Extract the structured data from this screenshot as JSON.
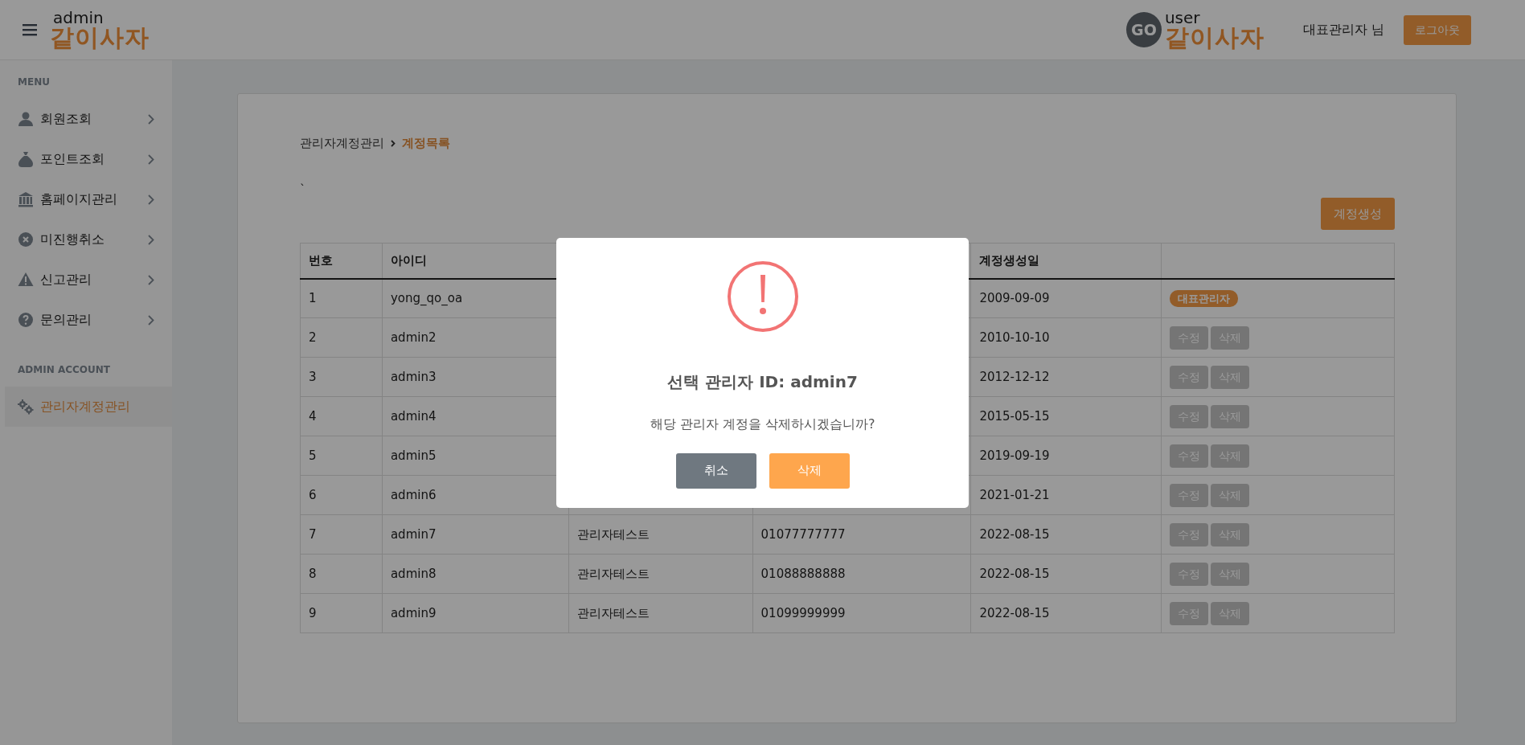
{
  "header": {
    "logo": {
      "sub": "admin",
      "main": "같이사자"
    },
    "user_logo": {
      "badge": "GO",
      "sub": "user",
      "main": "같이사자"
    },
    "user_name": "대표관리자 님",
    "logout": "로그아웃"
  },
  "sidebar": {
    "sections": [
      {
        "title": "MENU",
        "items": [
          {
            "label": "회원조회",
            "has_submenu": true,
            "selected": false
          },
          {
            "label": "포인트조회",
            "has_submenu": true,
            "selected": false
          },
          {
            "label": "홈페이지관리",
            "has_submenu": true,
            "selected": false
          },
          {
            "label": "미진행취소",
            "has_submenu": true,
            "selected": false
          },
          {
            "label": "신고관리",
            "has_submenu": true,
            "selected": false
          },
          {
            "label": "문의관리",
            "has_submenu": true,
            "selected": false
          }
        ]
      },
      {
        "title": "ADMIN ACCOUNT",
        "items": [
          {
            "label": "관리자계정관리",
            "has_submenu": false,
            "selected": true
          }
        ]
      }
    ]
  },
  "breadcrumb": [
    {
      "label": "관리자계정관리",
      "current": false
    },
    {
      "label": "계정목록",
      "current": true
    }
  ],
  "stray_mark": "`",
  "create_button": "계정생성",
  "table": {
    "columns": [
      {
        "label": "번호"
      },
      {
        "label": "아이디"
      },
      {},
      {},
      {
        "label": "계정생성일"
      },
      {}
    ],
    "rows": [
      {
        "number": "1",
        "id": "yong_qo_oa",
        "created": "2009-09-09",
        "kind": "owner",
        "badge": "대표관리자"
      },
      {
        "number": "2",
        "id": "admin2",
        "created": "2010-10-10",
        "kind": "editable",
        "actions": [
          "수정",
          "삭제"
        ]
      },
      {
        "number": "3",
        "id": "admin3",
        "created": "2012-12-12",
        "kind": "editable",
        "actions": [
          "수정",
          "삭제"
        ]
      },
      {
        "number": "4",
        "id": "admin4",
        "created": "2015-05-15",
        "kind": "editable",
        "actions": [
          "수정",
          "삭제"
        ]
      },
      {
        "number": "5",
        "id": "admin5",
        "created": "2019-09-19",
        "kind": "editable",
        "actions": [
          "수정",
          "삭제"
        ]
      },
      {
        "number": "6",
        "id": "admin6",
        "created": "2021-01-21",
        "kind": "editable",
        "actions": [
          "수정",
          "삭제"
        ]
      },
      {
        "number": "7",
        "id": "admin7",
        "column_3": "관리자테스트",
        "column_4": "01077777777",
        "created": "2022-08-15",
        "kind": "editable",
        "actions": [
          "수정",
          "삭제"
        ]
      },
      {
        "number": "8",
        "id": "admin8",
        "column_3": "관리자테스트",
        "column_4": "01088888888",
        "created": "2022-08-15",
        "kind": "editable",
        "actions": [
          "수정",
          "삭제"
        ]
      },
      {
        "number": "9",
        "id": "admin9",
        "column_3": "관리자테스트",
        "column_4": "01099999999",
        "created": "2022-08-15",
        "kind": "editable",
        "actions": [
          "수정",
          "삭제"
        ]
      }
    ]
  },
  "modal": {
    "title": "선택 관리자 ID: admin7",
    "message": "해당 관리자 계정을 삭제하시겠습니까?",
    "buttons": [
      {
        "label": "취소",
        "kind": "cancel"
      },
      {
        "label": "삭제",
        "kind": "confirm"
      }
    ]
  }
}
